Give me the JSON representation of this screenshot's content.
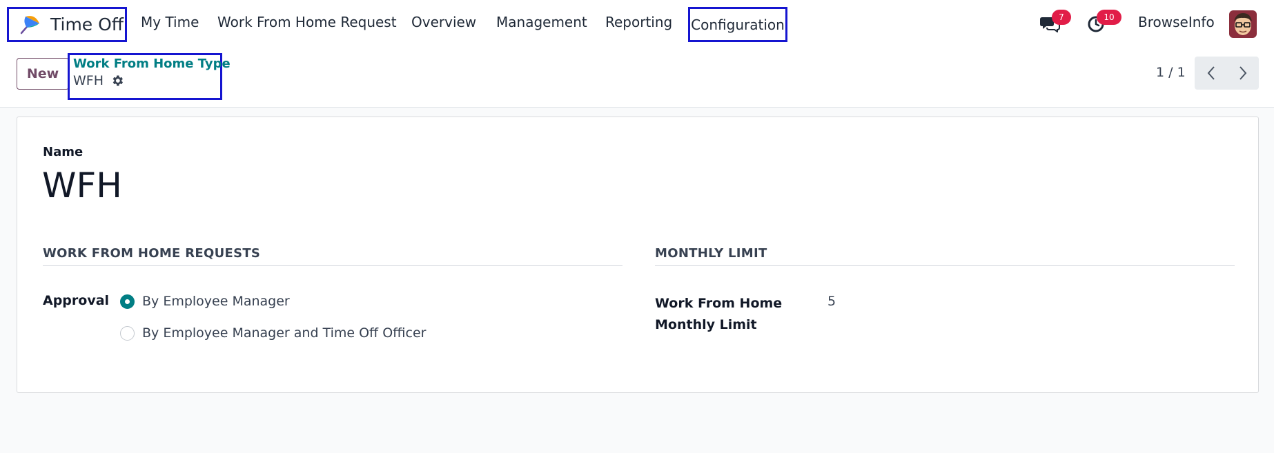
{
  "navbar": {
    "app_name": "Time Off",
    "menu": [
      "My Time",
      "Work From Home Request",
      "Overview",
      "Management",
      "Reporting"
    ],
    "config_label": "Configuration",
    "messages_count": "7",
    "activities_count": "10",
    "user_name": "BrowseInfo"
  },
  "control_panel": {
    "new_label": "New",
    "breadcrumb_parent": "Work From Home Type",
    "breadcrumb_current": "WFH",
    "pager_value": "1 / 1"
  },
  "form": {
    "name_label": "Name",
    "name_value": "WFH",
    "section_requests_title": "WORK FROM HOME REQUESTS",
    "approval_label": "Approval",
    "approval_options": [
      "By Employee Manager",
      "By Employee Manager and Time Off Officer"
    ],
    "approval_selected_index": 0,
    "section_limit_title": "MONTHLY LIMIT",
    "limit_label": "Work From Home Monthly Limit",
    "limit_value": "5"
  },
  "colors": {
    "accent": "#017e84",
    "primary": "#714b67",
    "badge": "#e11d48",
    "highlight_box": "#1515d0"
  },
  "icons": {
    "app_logo": "umbrella-icon",
    "messages": "chat-bubbles-icon",
    "activities": "clock-icon",
    "record_actions": "gear-icon",
    "pager_prev": "chevron-left-icon",
    "pager_next": "chevron-right-icon"
  }
}
